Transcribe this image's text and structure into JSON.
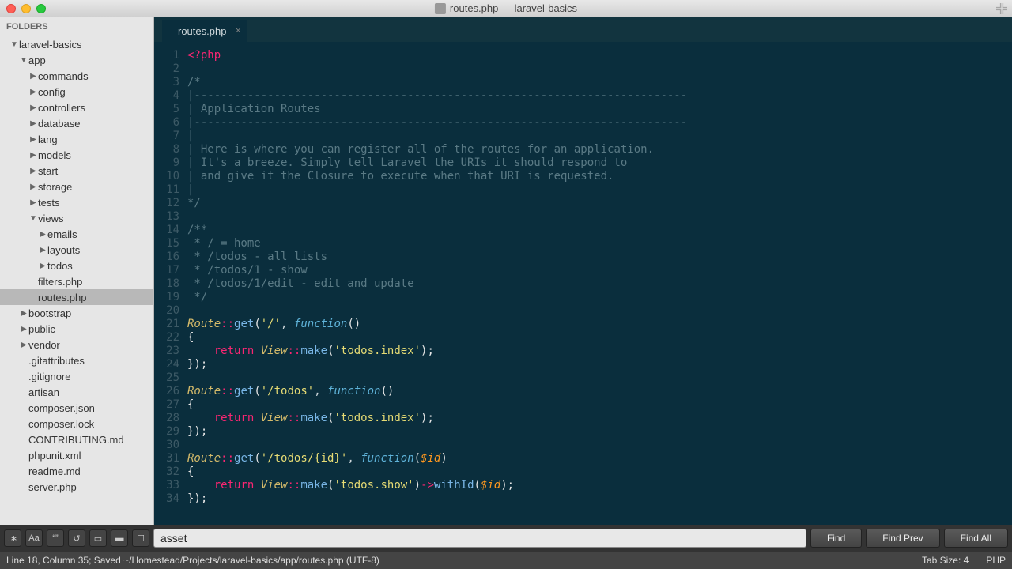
{
  "window": {
    "title": "routes.php — laravel-basics"
  },
  "sidebar": {
    "header": "FOLDERS",
    "rows": [
      {
        "indent": 1,
        "twisty": "▼",
        "label": "laravel-basics",
        "type": "folder"
      },
      {
        "indent": 2,
        "twisty": "▼",
        "label": "app",
        "type": "folder"
      },
      {
        "indent": 3,
        "twisty": "▶",
        "label": "commands",
        "type": "folder"
      },
      {
        "indent": 3,
        "twisty": "▶",
        "label": "config",
        "type": "folder"
      },
      {
        "indent": 3,
        "twisty": "▶",
        "label": "controllers",
        "type": "folder"
      },
      {
        "indent": 3,
        "twisty": "▶",
        "label": "database",
        "type": "folder"
      },
      {
        "indent": 3,
        "twisty": "▶",
        "label": "lang",
        "type": "folder"
      },
      {
        "indent": 3,
        "twisty": "▶",
        "label": "models",
        "type": "folder"
      },
      {
        "indent": 3,
        "twisty": "▶",
        "label": "start",
        "type": "folder"
      },
      {
        "indent": 3,
        "twisty": "▶",
        "label": "storage",
        "type": "folder"
      },
      {
        "indent": 3,
        "twisty": "▶",
        "label": "tests",
        "type": "folder"
      },
      {
        "indent": 3,
        "twisty": "▼",
        "label": "views",
        "type": "folder"
      },
      {
        "indent": 4,
        "twisty": "▶",
        "label": "emails",
        "type": "folder"
      },
      {
        "indent": 4,
        "twisty": "▶",
        "label": "layouts",
        "type": "folder"
      },
      {
        "indent": 4,
        "twisty": "▶",
        "label": "todos",
        "type": "folder"
      },
      {
        "indent": 3,
        "twisty": "",
        "label": "filters.php",
        "type": "file"
      },
      {
        "indent": 3,
        "twisty": "",
        "label": "routes.php",
        "type": "file",
        "active": true
      },
      {
        "indent": 2,
        "twisty": "▶",
        "label": "bootstrap",
        "type": "folder"
      },
      {
        "indent": 2,
        "twisty": "▶",
        "label": "public",
        "type": "folder"
      },
      {
        "indent": 2,
        "twisty": "▶",
        "label": "vendor",
        "type": "folder"
      },
      {
        "indent": 2,
        "twisty": "",
        "label": ".gitattributes",
        "type": "file"
      },
      {
        "indent": 2,
        "twisty": "",
        "label": ".gitignore",
        "type": "file"
      },
      {
        "indent": 2,
        "twisty": "",
        "label": "artisan",
        "type": "file"
      },
      {
        "indent": 2,
        "twisty": "",
        "label": "composer.json",
        "type": "file"
      },
      {
        "indent": 2,
        "twisty": "",
        "label": "composer.lock",
        "type": "file"
      },
      {
        "indent": 2,
        "twisty": "",
        "label": "CONTRIBUTING.md",
        "type": "file"
      },
      {
        "indent": 2,
        "twisty": "",
        "label": "phpunit.xml",
        "type": "file"
      },
      {
        "indent": 2,
        "twisty": "",
        "label": "readme.md",
        "type": "file"
      },
      {
        "indent": 2,
        "twisty": "",
        "label": "server.php",
        "type": "file"
      }
    ]
  },
  "tabs": [
    {
      "label": "routes.php"
    }
  ],
  "code": {
    "lines": [
      [
        {
          "t": "<?php",
          "c": "c-tag"
        }
      ],
      [],
      [
        {
          "t": "/*",
          "c": "c-comment"
        }
      ],
      [
        {
          "t": "|--------------------------------------------------------------------------",
          "c": "c-comment"
        }
      ],
      [
        {
          "t": "| Application Routes",
          "c": "c-comment"
        }
      ],
      [
        {
          "t": "|--------------------------------------------------------------------------",
          "c": "c-comment"
        }
      ],
      [
        {
          "t": "|",
          "c": "c-comment"
        }
      ],
      [
        {
          "t": "| Here is where you can register all of the routes for an application.",
          "c": "c-comment"
        }
      ],
      [
        {
          "t": "| It's a breeze. Simply tell Laravel the URIs it should respond to",
          "c": "c-comment"
        }
      ],
      [
        {
          "t": "| and give it the Closure to execute when that URI is requested.",
          "c": "c-comment"
        }
      ],
      [
        {
          "t": "|",
          "c": "c-comment"
        }
      ],
      [
        {
          "t": "*/",
          "c": "c-comment"
        }
      ],
      [],
      [
        {
          "t": "/**",
          "c": "c-comment"
        }
      ],
      [
        {
          "t": " * / = home",
          "c": "c-comment"
        }
      ],
      [
        {
          "t": " * /todos - all lists",
          "c": "c-comment"
        }
      ],
      [
        {
          "t": " * /todos/1 - show",
          "c": "c-comment"
        }
      ],
      [
        {
          "t": " * /todos/1/edit - edit and update",
          "c": "c-comment"
        }
      ],
      [
        {
          "t": " */",
          "c": "c-comment"
        }
      ],
      [],
      [
        {
          "t": "Route",
          "c": "c-class"
        },
        {
          "t": "::",
          "c": "c-op"
        },
        {
          "t": "get",
          "c": "c-fn"
        },
        {
          "t": "(",
          "c": "c-brace"
        },
        {
          "t": "'/'",
          "c": "c-str"
        },
        {
          "t": ", ",
          "c": ""
        },
        {
          "t": "function",
          "c": "c-kw"
        },
        {
          "t": "()",
          "c": "c-brace"
        }
      ],
      [
        {
          "t": "{",
          "c": "c-brace"
        }
      ],
      [
        {
          "t": "    ",
          "c": ""
        },
        {
          "t": "return",
          "c": "c-op"
        },
        {
          "t": " ",
          "c": ""
        },
        {
          "t": "View",
          "c": "c-class"
        },
        {
          "t": "::",
          "c": "c-op"
        },
        {
          "t": "make",
          "c": "c-fn"
        },
        {
          "t": "(",
          "c": "c-brace"
        },
        {
          "t": "'todos.index'",
          "c": "c-str"
        },
        {
          "t": ");",
          "c": "c-brace"
        }
      ],
      [
        {
          "t": "});",
          "c": "c-brace"
        }
      ],
      [],
      [
        {
          "t": "Route",
          "c": "c-class"
        },
        {
          "t": "::",
          "c": "c-op"
        },
        {
          "t": "get",
          "c": "c-fn"
        },
        {
          "t": "(",
          "c": "c-brace"
        },
        {
          "t": "'/todos'",
          "c": "c-str"
        },
        {
          "t": ", ",
          "c": ""
        },
        {
          "t": "function",
          "c": "c-kw"
        },
        {
          "t": "()",
          "c": "c-brace"
        }
      ],
      [
        {
          "t": "{",
          "c": "c-brace"
        }
      ],
      [
        {
          "t": "    ",
          "c": ""
        },
        {
          "t": "return",
          "c": "c-op"
        },
        {
          "t": " ",
          "c": ""
        },
        {
          "t": "View",
          "c": "c-class"
        },
        {
          "t": "::",
          "c": "c-op"
        },
        {
          "t": "make",
          "c": "c-fn"
        },
        {
          "t": "(",
          "c": "c-brace"
        },
        {
          "t": "'todos.index'",
          "c": "c-str"
        },
        {
          "t": ");",
          "c": "c-brace"
        }
      ],
      [
        {
          "t": "});",
          "c": "c-brace"
        }
      ],
      [],
      [
        {
          "t": "Route",
          "c": "c-class"
        },
        {
          "t": "::",
          "c": "c-op"
        },
        {
          "t": "get",
          "c": "c-fn"
        },
        {
          "t": "(",
          "c": "c-brace"
        },
        {
          "t": "'/todos/{id}'",
          "c": "c-str"
        },
        {
          "t": ", ",
          "c": ""
        },
        {
          "t": "function",
          "c": "c-kw"
        },
        {
          "t": "(",
          "c": "c-brace"
        },
        {
          "t": "$id",
          "c": "c-var"
        },
        {
          "t": ")",
          "c": "c-brace"
        }
      ],
      [
        {
          "t": "{",
          "c": "c-brace"
        }
      ],
      [
        {
          "t": "    ",
          "c": ""
        },
        {
          "t": "return",
          "c": "c-op"
        },
        {
          "t": " ",
          "c": ""
        },
        {
          "t": "View",
          "c": "c-class"
        },
        {
          "t": "::",
          "c": "c-op"
        },
        {
          "t": "make",
          "c": "c-fn"
        },
        {
          "t": "(",
          "c": "c-brace"
        },
        {
          "t": "'todos.show'",
          "c": "c-str"
        },
        {
          "t": ")",
          "c": "c-brace"
        },
        {
          "t": "->",
          "c": "c-op"
        },
        {
          "t": "withId",
          "c": "c-fn"
        },
        {
          "t": "(",
          "c": "c-brace"
        },
        {
          "t": "$id",
          "c": "c-var"
        },
        {
          "t": ");",
          "c": "c-brace"
        }
      ],
      [
        {
          "t": "});",
          "c": "c-brace"
        }
      ]
    ]
  },
  "find": {
    "value": "asset",
    "buttons": {
      "find": "Find",
      "prev": "Find Prev",
      "all": "Find All"
    }
  },
  "status": {
    "left": "Line 18, Column 35; Saved ~/Homestead/Projects/laravel-basics/app/routes.php (UTF-8)",
    "tabsize": "Tab Size: 4",
    "lang": "PHP"
  }
}
